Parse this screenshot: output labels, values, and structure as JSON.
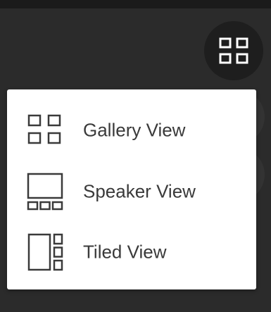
{
  "colors": {
    "background": "#2b2b2b",
    "toggle_background": "#1e1e1e",
    "toggle_icon": "#ffffff",
    "menu_background": "#ffffff",
    "menu_text": "#3a3a3a",
    "menu_icon": "#3a3a3a"
  },
  "toggle": {
    "icon": "grid-icon"
  },
  "menu": {
    "items": [
      {
        "label": "Gallery View",
        "icon": "gallery-view-icon"
      },
      {
        "label": "Speaker View",
        "icon": "speaker-view-icon"
      },
      {
        "label": "Tiled View",
        "icon": "tiled-view-icon"
      }
    ]
  }
}
